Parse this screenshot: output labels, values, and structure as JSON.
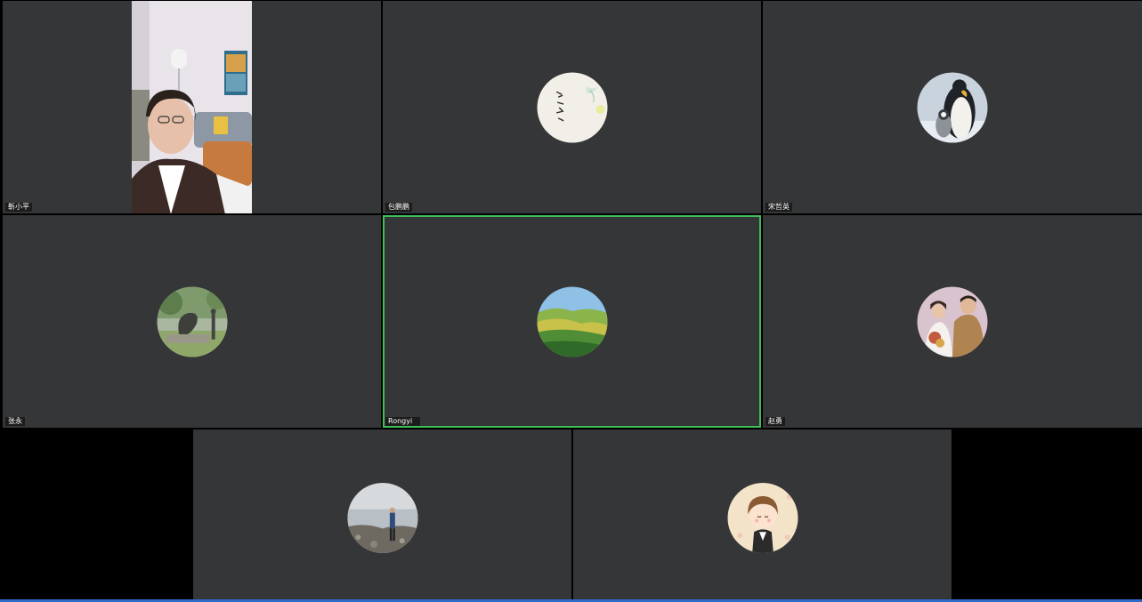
{
  "participants": [
    {
      "name": "靳小平",
      "kind": "video",
      "icon": "woman-video-feed"
    },
    {
      "name": "包鹏鹏",
      "kind": "avatar",
      "icon": "calligraphy-avatar"
    },
    {
      "name": "宋哲英",
      "kind": "avatar",
      "icon": "penguin-avatar"
    },
    {
      "name": "张永",
      "kind": "avatar",
      "icon": "sculpture-avatar"
    },
    {
      "name": "Rongyi",
      "kind": "avatar",
      "icon": "landscape-avatar",
      "active": true
    },
    {
      "name": "赵勇",
      "kind": "avatar",
      "icon": "couple-avatar"
    },
    {
      "name": "",
      "kind": "avatar",
      "icon": "shore-person-avatar"
    },
    {
      "name": "",
      "kind": "avatar",
      "icon": "cartoon-boy-avatar"
    }
  ],
  "colors": {
    "tile_bg": "#353637",
    "active_border": "#3fbf57",
    "stage_bg": "#000000",
    "bottom_bar": "#2d6bc7"
  }
}
